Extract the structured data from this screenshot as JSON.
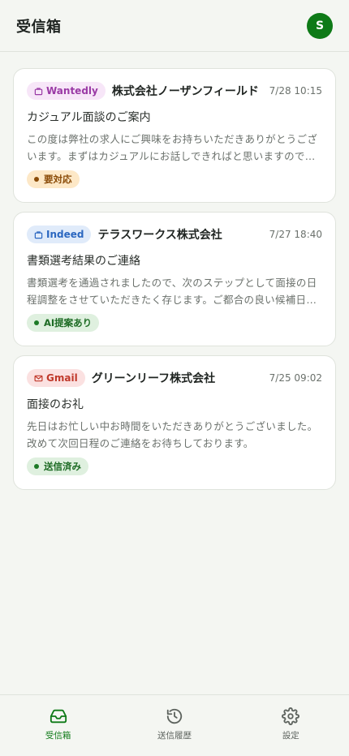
{
  "header": {
    "title": "受信箱",
    "avatar_initial": "S"
  },
  "messages": [
    {
      "source": "Wantedly",
      "source_icon": "briefcase-icon",
      "source_color": "#9a3aa5",
      "company": "株式会社ノーザンフィールド",
      "timestamp": "7/28 10:15",
      "subject": "カジュアル面談のご案内",
      "preview": "この度は弊社の求人にご興味をお持ちいただきありがとうございます。まずはカジュアルにお話しできればと思いますので…",
      "status": "要対応"
    },
    {
      "source": "Indeed",
      "source_icon": "briefcase-icon",
      "source_color": "#2b67c0",
      "company": "テラスワークス株式会社",
      "timestamp": "7/27 18:40",
      "subject": "書類選考結果のご連絡",
      "preview": "書類選考を通過されましたので、次のステップとして面接の日程調整をさせていただきたく存じます。ご都合の良い候補日…",
      "status": "AI提案あり"
    },
    {
      "source": "Gmail",
      "source_icon": "mail-icon",
      "source_color": "#c0392b",
      "company": "グリーンリーフ株式会社",
      "timestamp": "7/25 09:02",
      "subject": "面接のお礼",
      "preview": "先日はお忙しい中お時間をいただきありがとうございました。改めて次回日程のご連絡をお待ちしております。",
      "status": "送信済み"
    }
  ],
  "nav": {
    "items": [
      {
        "label": "受信箱",
        "icon": "inbox-icon",
        "active": true
      },
      {
        "label": "送信履歴",
        "icon": "history-icon",
        "active": false
      },
      {
        "label": "設定",
        "icon": "gear-icon",
        "active": false
      }
    ]
  },
  "colors": {
    "accent": "#0e7a17",
    "background": "#f4f6f2"
  }
}
